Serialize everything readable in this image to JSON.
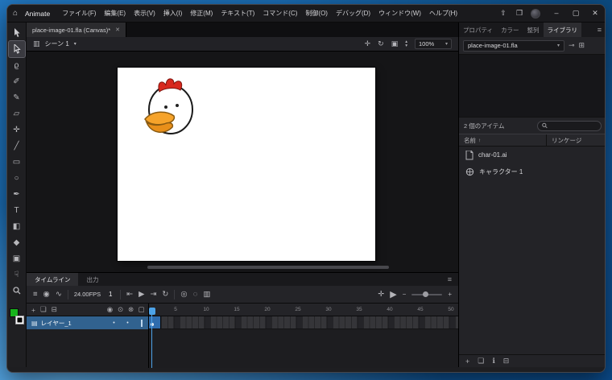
{
  "colors": {
    "selection_blue": "#31628f",
    "stage": "#ffffff",
    "fill_swatch": "#17b31b",
    "comb_red": "#d8281e",
    "beak_orange": "#f6a32a"
  },
  "titlebar": {
    "app_name": "Animate",
    "menus": [
      "ファイル(F)",
      "編集(E)",
      "表示(V)",
      "挿入(I)",
      "修正(M)",
      "テキスト(T)",
      "コマンド(C)",
      "制御(O)",
      "デバッグ(D)",
      "ウィンドウ(W)",
      "ヘルプ(H)"
    ]
  },
  "icons": {
    "home": "⌂",
    "share": "⇧",
    "workspace": "❒",
    "minimize": "–",
    "maximize": "▢",
    "close": "✕",
    "tab_close": "✕",
    "clapper": "▥",
    "chevron_down": "▾",
    "center_stage": "✛",
    "rotate": "↻",
    "clip_content": "▣",
    "step_up": "▴",
    "step_down": "▾",
    "tl_layers": "≡",
    "tl_camera": "◉",
    "tl_graph": "∿",
    "step_back": "⇤",
    "play": "▶",
    "step_forward": "⇥",
    "loop": "↻",
    "onion": "◎",
    "onion_outline": "◌",
    "multi_frame": "▥",
    "center_playhead": "✛",
    "minus": "−",
    "plus": "+",
    "add_layer": "+",
    "new_folder": "❏",
    "delete": "⊟",
    "cam_col": "◉",
    "eye_col": "⊙",
    "lock_col": "⊗",
    "outline_col": "▢",
    "layer_page": "▤",
    "dot": "•",
    "pin": "⊸",
    "new_panel": "⊞",
    "sort_up": "↑",
    "menu": "≡",
    "lib_new": "+",
    "lib_folder": "❏",
    "lib_props": "ℹ",
    "lib_delete": "⊟"
  },
  "doc_tab": {
    "title": "place-image-01.fla (Canvas)*"
  },
  "edit_bar": {
    "scene": "シーン 1",
    "zoom": "100%"
  },
  "tools": {
    "lasso": "ϱ",
    "fluid_brush": "✐",
    "classic_brush": "✎",
    "eraser": "▱",
    "asset_warp": "✛",
    "line": "╱",
    "rectangle": "▭",
    "oval": "○",
    "pen": "✒",
    "text": "T",
    "paint_bucket": "◧",
    "eyedropper": "◆",
    "camera": "▣",
    "hand": "☟"
  },
  "timeline": {
    "tabs": [
      "タイムライン",
      "出力"
    ],
    "fps": "24.00FPS",
    "frame": "1",
    "ruler": [
      "5",
      "10",
      "15",
      "20",
      "25",
      "30",
      "35",
      "40",
      "45",
      "50"
    ],
    "layers": [
      {
        "name": "レイヤー_1"
      }
    ]
  },
  "library": {
    "tabs": [
      "プロパティ",
      "カラー",
      "整列",
      "ライブラリ"
    ],
    "document": "place-image-01.fla",
    "count": "2 個のアイテム",
    "columns": {
      "name": "名前",
      "linkage": "リンケージ"
    },
    "items": [
      {
        "label": "char-01.ai"
      },
      {
        "label": "キャラクター 1"
      }
    ]
  }
}
